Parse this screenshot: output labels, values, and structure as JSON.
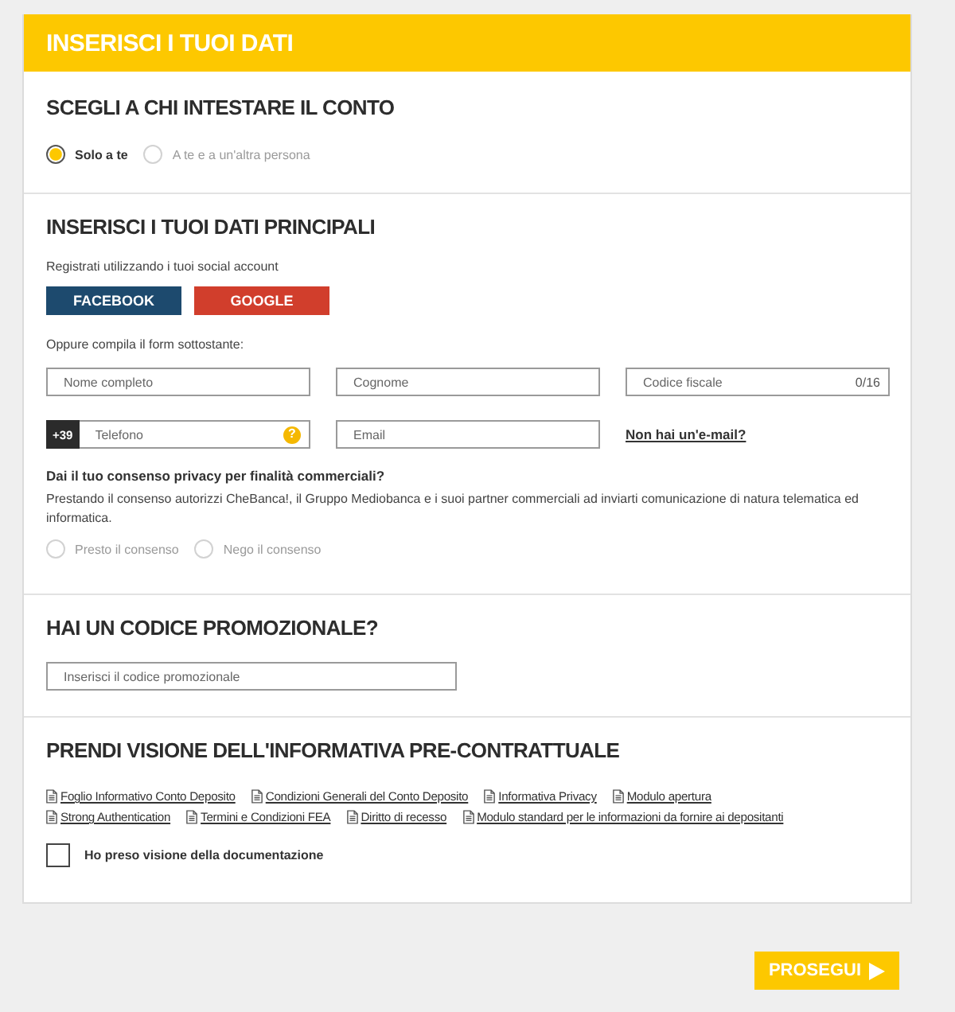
{
  "header": {
    "title": "INSERISCI I TUOI DATI"
  },
  "account_holder": {
    "title": "SCEGLI A CHI INTESTARE IL CONTO",
    "options": [
      {
        "label": "Solo a te",
        "selected": true
      },
      {
        "label": "A te e a un'altra persona",
        "selected": false
      }
    ]
  },
  "main_data": {
    "title": "INSERISCI I TUOI DATI PRINCIPALI",
    "social_prompt": "Registrati utilizzando i tuoi social account",
    "social_buttons": [
      {
        "label": "FACEBOOK",
        "color": "#1d4a6e"
      },
      {
        "label": "GOOGLE",
        "color": "#d13e2c"
      }
    ],
    "form_prompt": "Oppure compila il form sottostante:",
    "field_rows": [
      [
        {
          "kind": "input",
          "placeholder": "Nome completo"
        },
        {
          "kind": "input",
          "placeholder": "Cognome"
        },
        {
          "kind": "input",
          "placeholder": "Codice fiscale",
          "counter": "0/16"
        }
      ],
      [
        {
          "kind": "phone",
          "prefix": "+39",
          "placeholder": "Telefono",
          "help_icon": "?"
        },
        {
          "kind": "input",
          "placeholder": "Email"
        },
        {
          "kind": "link",
          "label": "Non hai un'e-mail?"
        }
      ]
    ],
    "privacy": {
      "question": "Dai il tuo consenso privacy per finalità commerciali?",
      "text": "Prestando il consenso autorizzi CheBanca!, il Gruppo Mediobanca e i suoi partner commerciali ad inviarti comunicazione di natura telematica ed informatica.",
      "options": [
        {
          "label": "Presto il consenso",
          "selected": false
        },
        {
          "label": "Nego il consenso",
          "selected": false
        }
      ]
    }
  },
  "promo": {
    "title": "HAI UN CODICE PROMOZIONALE?",
    "placeholder": "Inserisci il codice promozionale"
  },
  "documents": {
    "title": "PRENDI VISIONE DELL'INFORMATIVA PRE-CONTRATTUALE",
    "link_rows": [
      [
        "Foglio Informativo Conto Deposito",
        "Condizioni Generali del Conto Deposito",
        "Informativa Privacy",
        "Modulo apertura"
      ],
      [
        "Strong Authentication",
        "Termini e Condizioni FEA",
        "Diritto di recesso",
        "Modulo standard per le informazioni da fornire ai depositanti"
      ]
    ],
    "confirmation": {
      "label": "Ho preso visione della documentazione",
      "checked": false
    }
  },
  "next_button": {
    "label": "PROSEGUI"
  }
}
